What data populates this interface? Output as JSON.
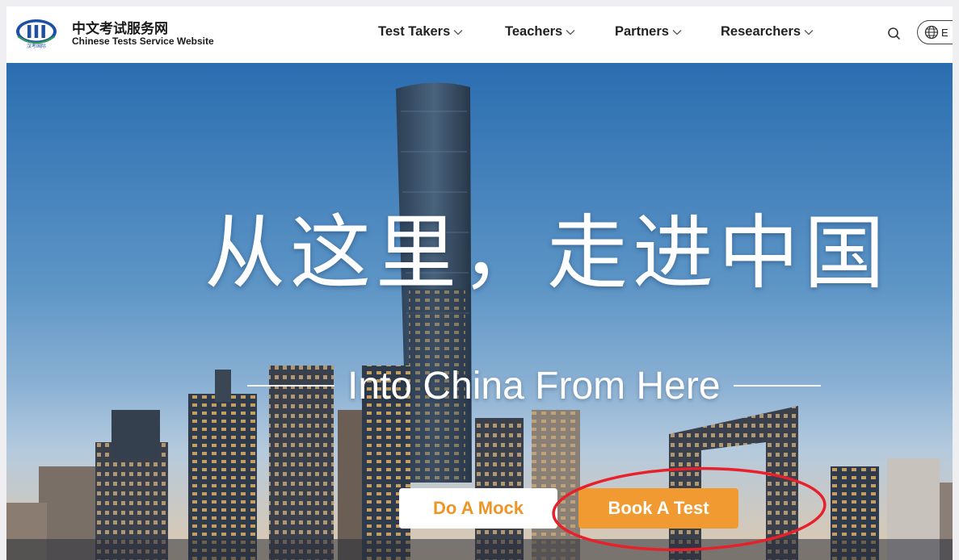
{
  "header": {
    "logo": {
      "chinese_name": "中文考试服务网",
      "english_name": "Chinese Tests Service Website",
      "emblem_text": "汉考国际"
    },
    "nav": [
      {
        "label": "Test Takers",
        "icon": "chevron-down-icon"
      },
      {
        "label": "Teachers",
        "icon": "chevron-down-icon"
      },
      {
        "label": "Partners",
        "icon": "chevron-down-icon"
      },
      {
        "label": "Researchers",
        "icon": "chevron-down-icon"
      }
    ],
    "search_icon": "search-icon",
    "language": {
      "icon": "globe-icon",
      "label": "E"
    }
  },
  "hero": {
    "headline": "从这里，走进中国",
    "subheadline": "Into China From Here",
    "buttons": {
      "mock": "Do A Mock",
      "book": "Book A Test"
    }
  },
  "colors": {
    "accent_orange": "#f19a31",
    "highlight_red": "#e8202a",
    "sky_top": "#2a6db0",
    "sky_bottom": "#b9cde0",
    "text_dark": "#222222"
  }
}
